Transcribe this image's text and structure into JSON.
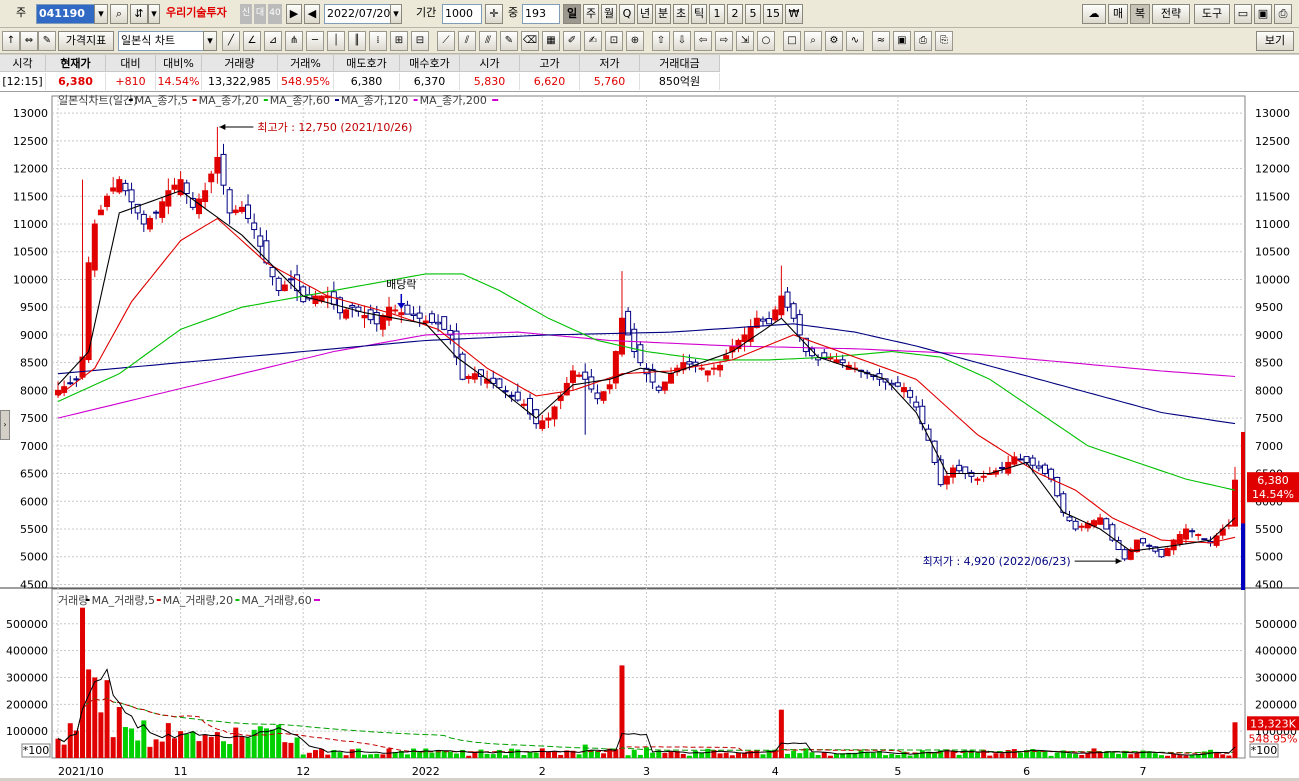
{
  "toolbar": {
    "prefix_label": "주",
    "code": "041190",
    "search_icon": "magnifier-icon",
    "sort_icon": "sort-arrows-icon",
    "stock_name": "우리기술투자",
    "badges": [
      "신",
      "대",
      "40"
    ],
    "date": "2022/07/20",
    "period_label": "기간",
    "period_value": "1000",
    "count_label": "중",
    "count_value": "193",
    "period_buttons": [
      "일",
      "주",
      "월",
      "Q",
      "년",
      "분",
      "초",
      "틱",
      "1",
      "2",
      "5",
      "15",
      "₩"
    ],
    "active_period": "일",
    "right_buttons": [
      "매",
      "복",
      "전략",
      "도구"
    ],
    "right_icons": [
      "cloud-icon",
      "folder-icon",
      "save-icon",
      "print-icon"
    ]
  },
  "toolbar2": {
    "price_indicator_label": "가격지표",
    "chart_type": "일본식 차트",
    "view_button": "보기",
    "tool_icons": [
      "cursor-icon",
      "trendline-icon",
      "angle-icon",
      "fan-icon",
      "pitchfork-icon",
      "hline-icon",
      "vline-icon",
      "vlines-icon",
      "cycle-icon",
      "grid-icon",
      "fibo-icon",
      "channel-icon",
      "parallel-icon",
      "regression-icon",
      "pencil-icon",
      "eraser-icon",
      "fill-icon",
      "marker-icon",
      "note-icon",
      "text-icon",
      "zoom-icon",
      "arrow-up-icon",
      "arrow-down-icon",
      "arrow-left-icon",
      "arrow-right-icon",
      "cross-icon",
      "circle-icon",
      "rect-icon",
      "search-icon",
      "settings-icon",
      "wave-icon",
      "pattern-icon",
      "image-icon",
      "printer-icon"
    ]
  },
  "info": {
    "headers": [
      "시각",
      "현재가",
      "대비",
      "대비%",
      "거래량",
      "거래%",
      "매도호가",
      "매수호가",
      "시가",
      "고가",
      "저가",
      "거래대금"
    ],
    "values": [
      "[12:15]",
      "6,380",
      "+810",
      "14.54%",
      "13,322,985",
      "548.95%",
      "6,380",
      "6,370",
      "5,830",
      "6,620",
      "5,760",
      "850억원"
    ],
    "red_columns": [
      1,
      2,
      3,
      5,
      8,
      9,
      10
    ]
  },
  "legend_price": {
    "title": "일본식차트(일간)",
    "items": [
      {
        "label": "MA_종가,5",
        "color": "#000000"
      },
      {
        "label": "MA_종가,20",
        "color": "#e00000"
      },
      {
        "label": "MA_종가,60",
        "color": "#00c000"
      },
      {
        "label": "MA_종가,120",
        "color": "#000080"
      },
      {
        "label": "MA_종가,200",
        "color": "#d000d0"
      }
    ]
  },
  "legend_volume": {
    "title": "거래량",
    "items": [
      {
        "label": "MA_거래량,5",
        "color": "#000000"
      },
      {
        "label": "MA_거래량,20",
        "color": "#e00000"
      },
      {
        "label": "MA_거래량,60",
        "color": "#00c000"
      }
    ]
  },
  "annotations": {
    "high": "최고가 : 12,750 (2021/10/26)",
    "low": "최저가 : 4,920 (2022/06/23)",
    "dividend": "배당락"
  },
  "price_tags": {
    "last_price": "6,380",
    "change_pct": "14.54%",
    "volume": "13,323K",
    "volume_pct": "548.95%",
    "scale_note": "*100"
  },
  "chart_data": {
    "type": "candlestick",
    "title": "일본식차트(일간)",
    "price_axis": {
      "ylim": [
        4400,
        13200
      ],
      "ticks": [
        4500,
        5000,
        5500,
        6000,
        6500,
        7000,
        7500,
        8000,
        8500,
        9000,
        9500,
        10000,
        10500,
        11000,
        11500,
        12000,
        12500,
        13000
      ]
    },
    "volume_axis": {
      "ylim": [
        0,
        570000
      ],
      "ticks": [
        100000,
        200000,
        300000,
        400000,
        500000
      ],
      "tick_labels": [
        "100000",
        "200000",
        "300000",
        "400000",
        "500000"
      ]
    },
    "x_axis": {
      "labels": [
        "2021/10",
        "11",
        "12",
        "2022",
        "2",
        "3",
        "4",
        "5",
        "6",
        "7"
      ],
      "label_index": [
        0,
        20,
        40,
        60,
        79,
        96,
        117,
        137,
        158,
        177
      ],
      "total_bars": 193
    },
    "trend_anchors": [
      [
        0,
        8000
      ],
      [
        3,
        8200
      ],
      [
        4,
        8600
      ],
      [
        5,
        10300
      ],
      [
        6,
        11000
      ],
      [
        8,
        11500
      ],
      [
        10,
        11800
      ],
      [
        12,
        11400
      ],
      [
        14,
        11000
      ],
      [
        16,
        11200
      ],
      [
        18,
        11600
      ],
      [
        20,
        11800
      ],
      [
        22,
        11300
      ],
      [
        24,
        11600
      ],
      [
        26,
        12200
      ],
      [
        28,
        11200
      ],
      [
        30,
        11300
      ],
      [
        32,
        10900
      ],
      [
        34,
        10300
      ],
      [
        36,
        9800
      ],
      [
        38,
        10000
      ],
      [
        40,
        9600
      ],
      [
        42,
        9700
      ],
      [
        44,
        9700
      ],
      [
        46,
        9400
      ],
      [
        48,
        9500
      ],
      [
        50,
        9350
      ],
      [
        52,
        9200
      ],
      [
        54,
        9500
      ],
      [
        56,
        9400
      ],
      [
        58,
        9350
      ],
      [
        60,
        9250
      ],
      [
        62,
        9200
      ],
      [
        64,
        9000
      ],
      [
        66,
        8200
      ],
      [
        68,
        8300
      ],
      [
        70,
        8200
      ],
      [
        72,
        8050
      ],
      [
        74,
        7900
      ],
      [
        76,
        7750
      ],
      [
        78,
        7400
      ],
      [
        80,
        7500
      ],
      [
        82,
        7900
      ],
      [
        84,
        8350
      ],
      [
        86,
        8200
      ],
      [
        88,
        7850
      ],
      [
        90,
        8100
      ],
      [
        92,
        9300
      ],
      [
        94,
        8700
      ],
      [
        96,
        8300
      ],
      [
        98,
        8000
      ],
      [
        100,
        8300
      ],
      [
        102,
        8500
      ],
      [
        104,
        8450
      ],
      [
        106,
        8350
      ],
      [
        108,
        8450
      ],
      [
        110,
        8800
      ],
      [
        112,
        9000
      ],
      [
        114,
        9300
      ],
      [
        116,
        9200
      ],
      [
        118,
        9700
      ],
      [
        120,
        9300
      ],
      [
        122,
        8700
      ],
      [
        124,
        8550
      ],
      [
        126,
        8600
      ],
      [
        128,
        8500
      ],
      [
        130,
        8400
      ],
      [
        132,
        8300
      ],
      [
        134,
        8200
      ],
      [
        136,
        8100
      ],
      [
        138,
        8050
      ],
      [
        140,
        7700
      ],
      [
        142,
        7100
      ],
      [
        144,
        6300
      ],
      [
        146,
        6600
      ],
      [
        148,
        6500
      ],
      [
        150,
        6400
      ],
      [
        152,
        6500
      ],
      [
        154,
        6600
      ],
      [
        156,
        6800
      ],
      [
        158,
        6700
      ],
      [
        160,
        6600
      ],
      [
        162,
        6400
      ],
      [
        164,
        5800
      ],
      [
        166,
        5500
      ],
      [
        168,
        5600
      ],
      [
        170,
        5700
      ],
      [
        172,
        5300
      ],
      [
        174,
        4960
      ],
      [
        176,
        5300
      ],
      [
        178,
        5200
      ],
      [
        180,
        5000
      ],
      [
        182,
        5300
      ],
      [
        184,
        5500
      ],
      [
        186,
        5400
      ],
      [
        188,
        5250
      ],
      [
        190,
        5500
      ],
      [
        191,
        5570
      ],
      [
        192,
        6380
      ]
    ],
    "spikes": [
      [
        4,
        11800
      ],
      [
        26,
        12750
      ],
      [
        86,
        7200
      ],
      [
        92,
        10150
      ],
      [
        118,
        10250
      ],
      [
        120,
        9600
      ],
      [
        174,
        4920
      ],
      [
        192,
        6620
      ]
    ],
    "ma5_anchors": [
      [
        0,
        8100
      ],
      [
        5,
        8700
      ],
      [
        10,
        11200
      ],
      [
        20,
        11600
      ],
      [
        30,
        10800
      ],
      [
        40,
        9700
      ],
      [
        50,
        9400
      ],
      [
        60,
        9200
      ],
      [
        65,
        8600
      ],
      [
        70,
        8200
      ],
      [
        78,
        7500
      ],
      [
        84,
        8100
      ],
      [
        90,
        8200
      ],
      [
        95,
        8400
      ],
      [
        100,
        8300
      ],
      [
        110,
        8700
      ],
      [
        118,
        9300
      ],
      [
        124,
        8600
      ],
      [
        135,
        8200
      ],
      [
        140,
        7600
      ],
      [
        145,
        6500
      ],
      [
        152,
        6500
      ],
      [
        158,
        6700
      ],
      [
        164,
        5800
      ],
      [
        170,
        5500
      ],
      [
        175,
        5100
      ],
      [
        182,
        5200
      ],
      [
        188,
        5300
      ],
      [
        192,
        5700
      ]
    ],
    "ma20_anchors": [
      [
        0,
        7900
      ],
      [
        6,
        8400
      ],
      [
        12,
        9600
      ],
      [
        20,
        10700
      ],
      [
        26,
        11100
      ],
      [
        34,
        10300
      ],
      [
        44,
        9700
      ],
      [
        54,
        9400
      ],
      [
        62,
        9100
      ],
      [
        70,
        8400
      ],
      [
        78,
        7900
      ],
      [
        84,
        8000
      ],
      [
        92,
        8300
      ],
      [
        100,
        8350
      ],
      [
        110,
        8550
      ],
      [
        120,
        9000
      ],
      [
        130,
        8600
      ],
      [
        140,
        8200
      ],
      [
        150,
        7200
      ],
      [
        160,
        6500
      ],
      [
        166,
        6200
      ],
      [
        172,
        5700
      ],
      [
        180,
        5300
      ],
      [
        188,
        5250
      ],
      [
        192,
        5350
      ]
    ],
    "ma60_anchors": [
      [
        0,
        7800
      ],
      [
        10,
        8300
      ],
      [
        20,
        9100
      ],
      [
        30,
        9500
      ],
      [
        40,
        9700
      ],
      [
        50,
        9900
      ],
      [
        60,
        10100
      ],
      [
        66,
        10100
      ],
      [
        72,
        9800
      ],
      [
        80,
        9300
      ],
      [
        88,
        8900
      ],
      [
        96,
        8700
      ],
      [
        106,
        8550
      ],
      [
        116,
        8550
      ],
      [
        126,
        8600
      ],
      [
        136,
        8700
      ],
      [
        144,
        8600
      ],
      [
        152,
        8200
      ],
      [
        160,
        7600
      ],
      [
        168,
        7000
      ],
      [
        176,
        6700
      ],
      [
        184,
        6400
      ],
      [
        192,
        6200
      ]
    ],
    "ma120_anchors": [
      [
        0,
        8300
      ],
      [
        20,
        8500
      ],
      [
        40,
        8700
      ],
      [
        60,
        8900
      ],
      [
        80,
        9000
      ],
      [
        100,
        9050
      ],
      [
        120,
        9200
      ],
      [
        130,
        9050
      ],
      [
        140,
        8800
      ],
      [
        150,
        8500
      ],
      [
        160,
        8200
      ],
      [
        170,
        7900
      ],
      [
        180,
        7600
      ],
      [
        192,
        7400
      ]
    ],
    "ma200_anchors": [
      [
        0,
        7500
      ],
      [
        15,
        7900
      ],
      [
        30,
        8300
      ],
      [
        45,
        8700
      ],
      [
        60,
        9000
      ],
      [
        75,
        9050
      ],
      [
        90,
        8900
      ],
      [
        110,
        8800
      ],
      [
        130,
        8750
      ],
      [
        150,
        8650
      ],
      [
        165,
        8500
      ],
      [
        180,
        8350
      ],
      [
        192,
        8250
      ]
    ],
    "volume_spikes": [
      [
        4,
        560000
      ],
      [
        5,
        330000
      ],
      [
        6,
        300000
      ],
      [
        7,
        170000
      ],
      [
        8,
        290000
      ],
      [
        10,
        190000
      ],
      [
        12,
        110000
      ],
      [
        14,
        140000
      ],
      [
        18,
        130000
      ],
      [
        20,
        100000
      ],
      [
        30,
        80000
      ],
      [
        32,
        105000
      ],
      [
        92,
        345000
      ],
      [
        118,
        180000
      ],
      [
        86,
        50000
      ],
      [
        96,
        40000
      ],
      [
        192,
        133000
      ]
    ],
    "volume_base": 20000
  }
}
